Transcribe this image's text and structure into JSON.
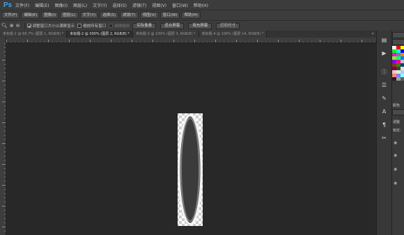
{
  "app": {
    "logo": "Ps"
  },
  "menu": {
    "items": [
      "文件(F)",
      "编辑(E)",
      "图像(I)",
      "图层(L)",
      "文字(Y)",
      "选择(S)",
      "滤镜(T)",
      "视图(V)",
      "窗口(W)",
      "帮助(H)"
    ]
  },
  "toolrow": {
    "items": [
      "文件(F)",
      "编辑(E)",
      "图像(I)",
      "图层(L)",
      "文字(Y)",
      "选择(S)",
      "滤镜(T)",
      "视图(V)",
      "窗口(W)",
      "帮助(H)"
    ]
  },
  "options": {
    "resize_label": "调整窗口大小以满屏显示",
    "resize_checked": true,
    "zoom_all_label": "缩放所有窗口",
    "zoom_all_checked": false,
    "scrubby_label": "细微缩放",
    "btn_actual": "实际像素",
    "btn_fit": "适合屏幕",
    "btn_fill": "填充屏幕",
    "btn_print": "打印尺寸"
  },
  "tabs": [
    {
      "label": "未标题-1 @ 66.7% (图层 1, RGB/8) *",
      "active": false
    },
    {
      "label": "未标题-2 @ 300% (图层 2, RGB/8) *",
      "active": true
    },
    {
      "label": "未标题-3 @ 100% (图层 3, RGB/8) *",
      "active": false
    },
    {
      "label": "未标题-4 @ 100% (图层 14, RGB/8) *",
      "active": false
    }
  ],
  "tab_overflow": "»",
  "panel": {
    "label_color": "颜色",
    "label_adjust": "调整",
    "label_lock": "锁定:"
  },
  "colors": {
    "accent": "#31a8ff",
    "canvas": "#282828",
    "chrome": "#3c3c3c"
  },
  "swatch_colors": [
    "#ffffff",
    "#ff0000",
    "#ffff00",
    "#00ff00",
    "#00ffff",
    "#0000ff",
    "#ff00ff",
    "#808080",
    "#ff8000",
    "#80ff00",
    "#00ff80",
    "#0080ff",
    "#8000ff",
    "#ff0080",
    "#c0c0c0",
    "#804000",
    "#408000",
    "#004080",
    "#800040",
    "#404040",
    "#e0e0e0",
    "#ffc0c0",
    "#c0ffc0",
    "#c0c0ff",
    "#ff8080",
    "#8080ff",
    "#80ffff",
    "#202020",
    "#a0a0a0",
    "#606060"
  ]
}
